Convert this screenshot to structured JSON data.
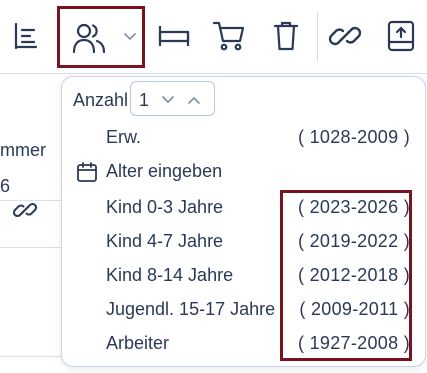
{
  "toolbar": {
    "icons": [
      "list-icon",
      "guests-icon",
      "chevron-down-icon",
      "bed-icon",
      "cart-icon",
      "trash-icon",
      "link-icon",
      "import-icon"
    ],
    "accent_color": "#2a3a56",
    "highlight_color": "#7a1320"
  },
  "background_table": {
    "header_fragment": "mmer",
    "cell_fragment": "6"
  },
  "guest_dropdown": {
    "quantity_label": "Anzahl",
    "quantity_value": "1",
    "items": [
      {
        "label": "Erw.",
        "range": "( 1028-2009 )"
      },
      {
        "label": "Alter eingeben",
        "range": ""
      },
      {
        "label": "Kind 0-3 Jahre",
        "range": "( 2023-2026 )"
      },
      {
        "label": "Kind 4-7 Jahre",
        "range": "( 2019-2022 )"
      },
      {
        "label": "Kind 8-14 Jahre",
        "range": "( 2012-2018 )"
      },
      {
        "label": "Jugendl. 15-17 Jahre",
        "range": "( 2009-2011 )"
      },
      {
        "label": "Arbeiter",
        "range": "( 1927-2008 )"
      }
    ]
  }
}
